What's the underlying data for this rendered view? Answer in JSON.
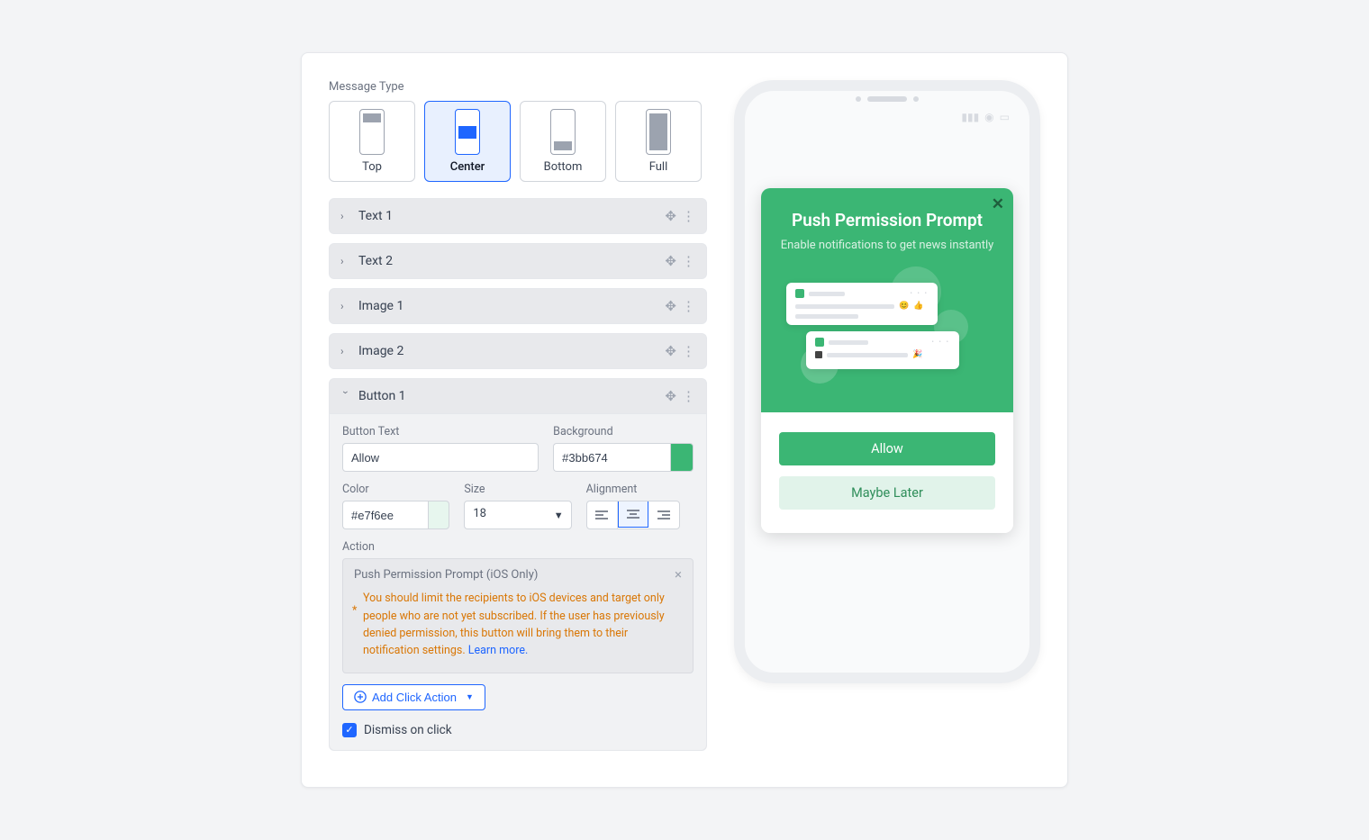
{
  "section_label": "Message Type",
  "msg_types": {
    "top": "Top",
    "center": "Center",
    "bottom": "Bottom",
    "full": "Full",
    "selected": "center"
  },
  "blocks": {
    "text1": "Text 1",
    "text2": "Text 2",
    "image1": "Image 1",
    "image2": "Image 2",
    "button1": "Button 1"
  },
  "button1": {
    "text_label": "Button Text",
    "text_value": "Allow",
    "bg_label": "Background",
    "bg_value": "#3bb674",
    "bg_swatch": "#3bb674",
    "color_label": "Color",
    "color_value": "#e7f6ee",
    "color_swatch": "#e7f6ee",
    "size_label": "Size",
    "size_value": "18",
    "align_label": "Alignment",
    "action_label": "Action",
    "action_value": "Push Permission Prompt (iOS Only)",
    "hint": "You should limit the recipients to iOS devices and target only people who are not yet subscribed. If the user has previously denied permission, this button will bring them to their notification settings. ",
    "hint_link": "Learn more.",
    "add_action": "Add Click Action",
    "dismiss_label": "Dismiss on click"
  },
  "preview": {
    "title": "Push Permission Prompt",
    "subtitle": "Enable notifications to get news instantly",
    "primary_btn": "Allow",
    "secondary_btn": "Maybe Later"
  }
}
